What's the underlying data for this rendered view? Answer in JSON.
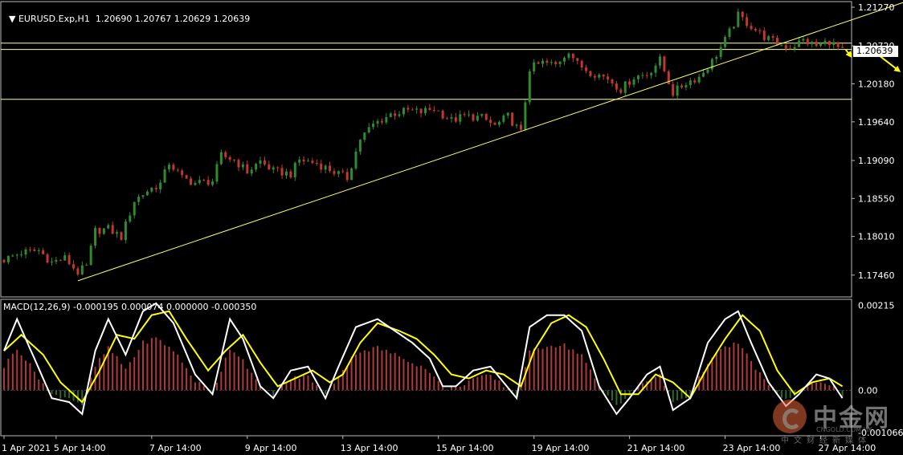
{
  "header": {
    "symbol_label": "EURUSD.Exp,H1",
    "ohlc": "1.20690 1.20767 1.20629 1.20639",
    "macd_label": "MACD(12,26,9) -0.000195 0.000074 0.000000 -0.000350"
  },
  "current_price_label": "1.20639",
  "watermark": {
    "brand": "中金网",
    "subtitle": "中文财经新媒体",
    "url": "CNGOLD.COM.HK"
  },
  "colors": {
    "background": "#000000",
    "bull_candle": "#2e8b2e",
    "bear_candle": "#c0392b",
    "trendline": "#ffff66",
    "macd_line": "#ffffff",
    "signal_line": "#ffff00",
    "hist_pos": "#b03a3a",
    "hist_neg": "#2c6b2c",
    "arrows": "#ffff00"
  },
  "chart_data": [
    {
      "type": "candlestick",
      "title": "EURUSD.Exp,H1",
      "y_ticks": [
        "1.21270",
        "1.20720",
        "1.20180",
        "1.19640",
        "1.19090",
        "1.18550",
        "1.18010",
        "1.17460"
      ],
      "y_range": [
        1.1715,
        1.2135
      ],
      "x_ticks": [
        "1 Apr 2021",
        "5 Apr 14:00",
        "7 Apr 14:00",
        "9 Apr 14:00",
        "13 Apr 14:00",
        "15 Apr 14:00",
        "19 Apr 14:00",
        "21 Apr 14:00",
        "23 Apr 14:00",
        "27 Apr 14:00"
      ],
      "close_path": [
        [
          0,
          1.1768
        ],
        [
          4,
          1.1778
        ],
        [
          8,
          1.1781
        ],
        [
          11,
          1.1764
        ],
        [
          14,
          1.177
        ],
        [
          17,
          1.175
        ],
        [
          19,
          1.1758
        ],
        [
          21,
          1.1809
        ],
        [
          24,
          1.1812
        ],
        [
          27,
          1.18
        ],
        [
          30,
          1.1852
        ],
        [
          33,
          1.1866
        ],
        [
          36,
          1.1876
        ],
        [
          38,
          1.1906
        ],
        [
          41,
          1.1884
        ],
        [
          44,
          1.1877
        ],
        [
          48,
          1.188
        ],
        [
          50,
          1.1916
        ],
        [
          53,
          1.191
        ],
        [
          56,
          1.1893
        ],
        [
          59,
          1.1908
        ],
        [
          62,
          1.1894
        ],
        [
          66,
          1.189
        ],
        [
          68,
          1.191
        ],
        [
          72,
          1.1905
        ],
        [
          75,
          1.1896
        ],
        [
          79,
          1.1884
        ],
        [
          82,
          1.194
        ],
        [
          85,
          1.196
        ],
        [
          89,
          1.1975
        ],
        [
          93,
          1.198
        ],
        [
          96,
          1.1978
        ],
        [
          99,
          1.1983
        ],
        [
          103,
          1.1966
        ],
        [
          106,
          1.1972
        ],
        [
          110,
          1.197
        ],
        [
          113,
          1.1958
        ],
        [
          116,
          1.1972
        ],
        [
          119,
          1.1948
        ],
        [
          121,
          1.204
        ],
        [
          124,
          1.2048
        ],
        [
          127,
          1.2045
        ],
        [
          130,
          1.2066
        ],
        [
          132,
          1.2046
        ],
        [
          135,
          1.2035
        ],
        [
          139,
          1.2026
        ],
        [
          142,
          1.201
        ],
        [
          145,
          1.2028
        ],
        [
          148,
          1.2032
        ],
        [
          151,
          1.2052
        ],
        [
          154,
          1.2005
        ],
        [
          157,
          1.202
        ],
        [
          160,
          1.2028
        ],
        [
          163,
          1.205
        ],
        [
          166,
          1.208
        ],
        [
          169,
          1.2115
        ],
        [
          172,
          1.21
        ],
        [
          175,
          1.2085
        ],
        [
          178,
          1.2075
        ],
        [
          181,
          1.207
        ],
        [
          184,
          1.208
        ],
        [
          187,
          1.2072
        ],
        [
          190,
          1.2079
        ],
        [
          193,
          1.2064
        ]
      ],
      "support_levels": [
        1.2076,
        1.2067,
        1.1996
      ],
      "trendline": [
        [
          17,
          1.1738
        ],
        [
          210,
          1.214
        ]
      ],
      "current_price": 1.20639
    },
    {
      "type": "macd",
      "title": "MACD(12,26,9)",
      "params": [
        12,
        26,
        9
      ],
      "values": {
        "main": -0.000195,
        "signal": 7.4e-05,
        "other": 0.0,
        "histogram": -0.00035
      },
      "y_ticks": [
        "0.00215",
        "0.00",
        "-0.001066"
      ],
      "y_range": [
        -0.00115,
        0.0023
      ],
      "macd_path": [
        [
          0,
          0.001
        ],
        [
          3,
          0.0018
        ],
        [
          7,
          0.0008
        ],
        [
          11,
          -0.0002
        ],
        [
          15,
          -0.0003
        ],
        [
          18,
          -0.0006
        ],
        [
          21,
          0.001
        ],
        [
          24,
          0.0018
        ],
        [
          28,
          0.0009
        ],
        [
          32,
          0.002
        ],
        [
          35,
          0.0022
        ],
        [
          39,
          0.0017
        ],
        [
          44,
          0.0004
        ],
        [
          48,
          -0.0001
        ],
        [
          52,
          0.0018
        ],
        [
          55,
          0.0013
        ],
        [
          59,
          0.0001
        ],
        [
          62,
          -0.0002
        ],
        [
          66,
          0.0005
        ],
        [
          70,
          0.0006
        ],
        [
          74,
          -0.0002
        ],
        [
          77,
          0.0006
        ],
        [
          81,
          0.0016
        ],
        [
          86,
          0.0018
        ],
        [
          90,
          0.0015
        ],
        [
          94,
          0.0012
        ],
        [
          98,
          0.0008
        ],
        [
          101,
          0.0001
        ],
        [
          104,
          0.0001
        ],
        [
          108,
          0.0005
        ],
        [
          112,
          0.0006
        ],
        [
          115,
          0.0002
        ],
        [
          118,
          -0.0002
        ],
        [
          121,
          0.0016
        ],
        [
          125,
          0.0019
        ],
        [
          129,
          0.0019
        ],
        [
          133,
          0.0015
        ],
        [
          137,
          0.0001
        ],
        [
          141,
          -0.0006
        ],
        [
          144,
          -0.0002
        ],
        [
          148,
          0.0004
        ],
        [
          151,
          0.0006
        ],
        [
          154,
          -0.0005
        ],
        [
          158,
          -0.0002
        ],
        [
          162,
          0.0012
        ],
        [
          166,
          0.0018
        ],
        [
          169,
          0.002
        ],
        [
          172,
          0.0012
        ],
        [
          176,
          0.0002
        ],
        [
          180,
          -0.0004
        ],
        [
          183,
          -0.0001
        ],
        [
          187,
          0.0004
        ],
        [
          190,
          0.0003
        ],
        [
          193,
          -0.0002
        ]
      ],
      "signal_path": [
        [
          0,
          0.001
        ],
        [
          4,
          0.0014
        ],
        [
          9,
          0.0009
        ],
        [
          13,
          0.0002
        ],
        [
          18,
          -0.0003
        ],
        [
          22,
          0.0005
        ],
        [
          26,
          0.0014
        ],
        [
          30,
          0.0013
        ],
        [
          34,
          0.0019
        ],
        [
          38,
          0.002
        ],
        [
          42,
          0.0013
        ],
        [
          47,
          0.0005
        ],
        [
          51,
          0.001
        ],
        [
          55,
          0.0014
        ],
        [
          59,
          0.0007
        ],
        [
          63,
          0.0001
        ],
        [
          67,
          0.0003
        ],
        [
          71,
          0.0005
        ],
        [
          75,
          0.0002
        ],
        [
          78,
          0.0004
        ],
        [
          82,
          0.0012
        ],
        [
          86,
          0.0017
        ],
        [
          91,
          0.0015
        ],
        [
          95,
          0.0013
        ],
        [
          99,
          0.0009
        ],
        [
          103,
          0.0004
        ],
        [
          107,
          0.0003
        ],
        [
          111,
          0.0005
        ],
        [
          115,
          0.0004
        ],
        [
          119,
          0.0001
        ],
        [
          122,
          0.001
        ],
        [
          126,
          0.0017
        ],
        [
          130,
          0.0019
        ],
        [
          134,
          0.0016
        ],
        [
          138,
          0.0008
        ],
        [
          142,
          -0.0001
        ],
        [
          146,
          -0.0001
        ],
        [
          150,
          0.0004
        ],
        [
          154,
          0.0002
        ],
        [
          158,
          -0.0002
        ],
        [
          162,
          0.0006
        ],
        [
          166,
          0.0013
        ],
        [
          170,
          0.0019
        ],
        [
          174,
          0.0015
        ],
        [
          178,
          0.0005
        ],
        [
          182,
          -0.0001
        ],
        [
          186,
          0.0002
        ],
        [
          190,
          0.0003
        ],
        [
          193,
          0.0001
        ]
      ]
    }
  ]
}
